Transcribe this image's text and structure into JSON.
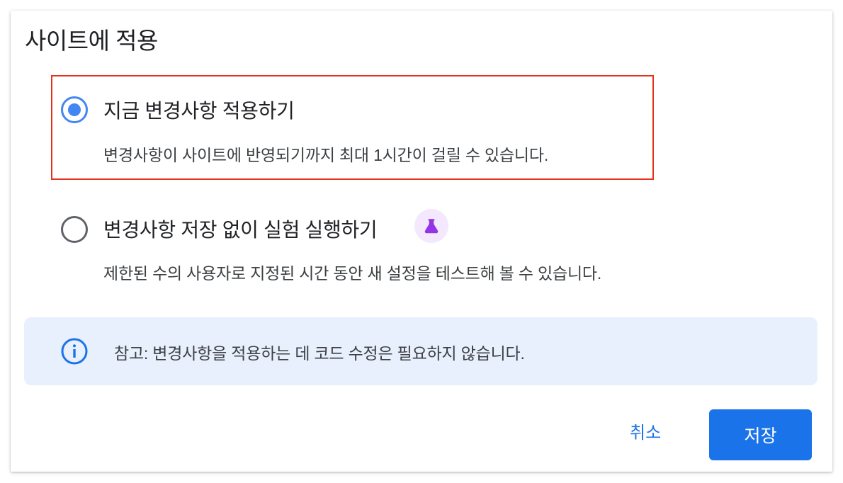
{
  "dialog": {
    "title": "사이트에 적용"
  },
  "options": [
    {
      "label": "지금 변경사항 적용하기",
      "description": "변경사항이 사이트에 반영되기까지 최대 1시간이 걸릴 수 있습니다.",
      "selected": true
    },
    {
      "label": "변경사항 저장 없이 실험 실행하기",
      "description": "제한된 수의 사용자로 지정된 시간 동안 새 설정을 테스트해 볼 수 있습니다.",
      "selected": false,
      "badge_icon": "flask-icon"
    }
  ],
  "note": {
    "icon": "info-icon",
    "text": "참고: 변경사항을 적용하는 데 코드 수정은 필요하지 않습니다."
  },
  "actions": {
    "cancel_label": "취소",
    "save_label": "저장"
  },
  "colors": {
    "accent": "#1a73e8",
    "radio_selected": "#4285f4",
    "highlight_border": "#e5331b",
    "note_background": "#e8f0fe",
    "badge_background": "#f3e8fd",
    "badge_icon": "#9334e6"
  }
}
